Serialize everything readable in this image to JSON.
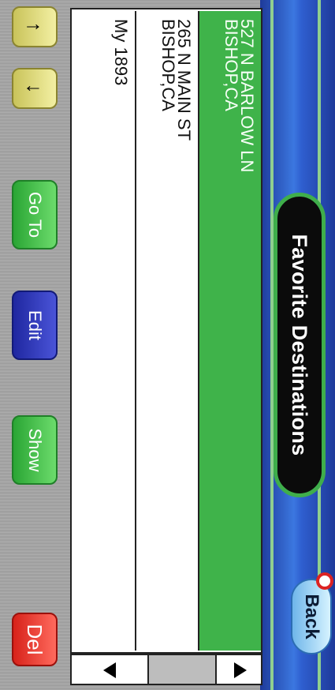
{
  "header": {
    "title": "Favorite Destinations",
    "back_label": "Back"
  },
  "favorites": [
    {
      "line1": "527 N BARLOW LN",
      "line2": "BISHOP,CA",
      "selected": true
    },
    {
      "line1": "265 N MAIN ST",
      "line2": "BISHOP,CA",
      "selected": false
    },
    {
      "line1": "My 1893",
      "line2": "",
      "selected": false
    }
  ],
  "toolbar": {
    "up_arrow": "↑",
    "down_arrow": "↓",
    "goto_label": "Go To",
    "edit_label": "Edit",
    "show_label": "Show",
    "delete_label": "Del"
  },
  "colors": {
    "selected_row": "#3fb34a",
    "goto_button": "#2aa534",
    "edit_button": "#1f27a0",
    "show_button": "#2aa534",
    "delete_button": "#d7221a"
  }
}
